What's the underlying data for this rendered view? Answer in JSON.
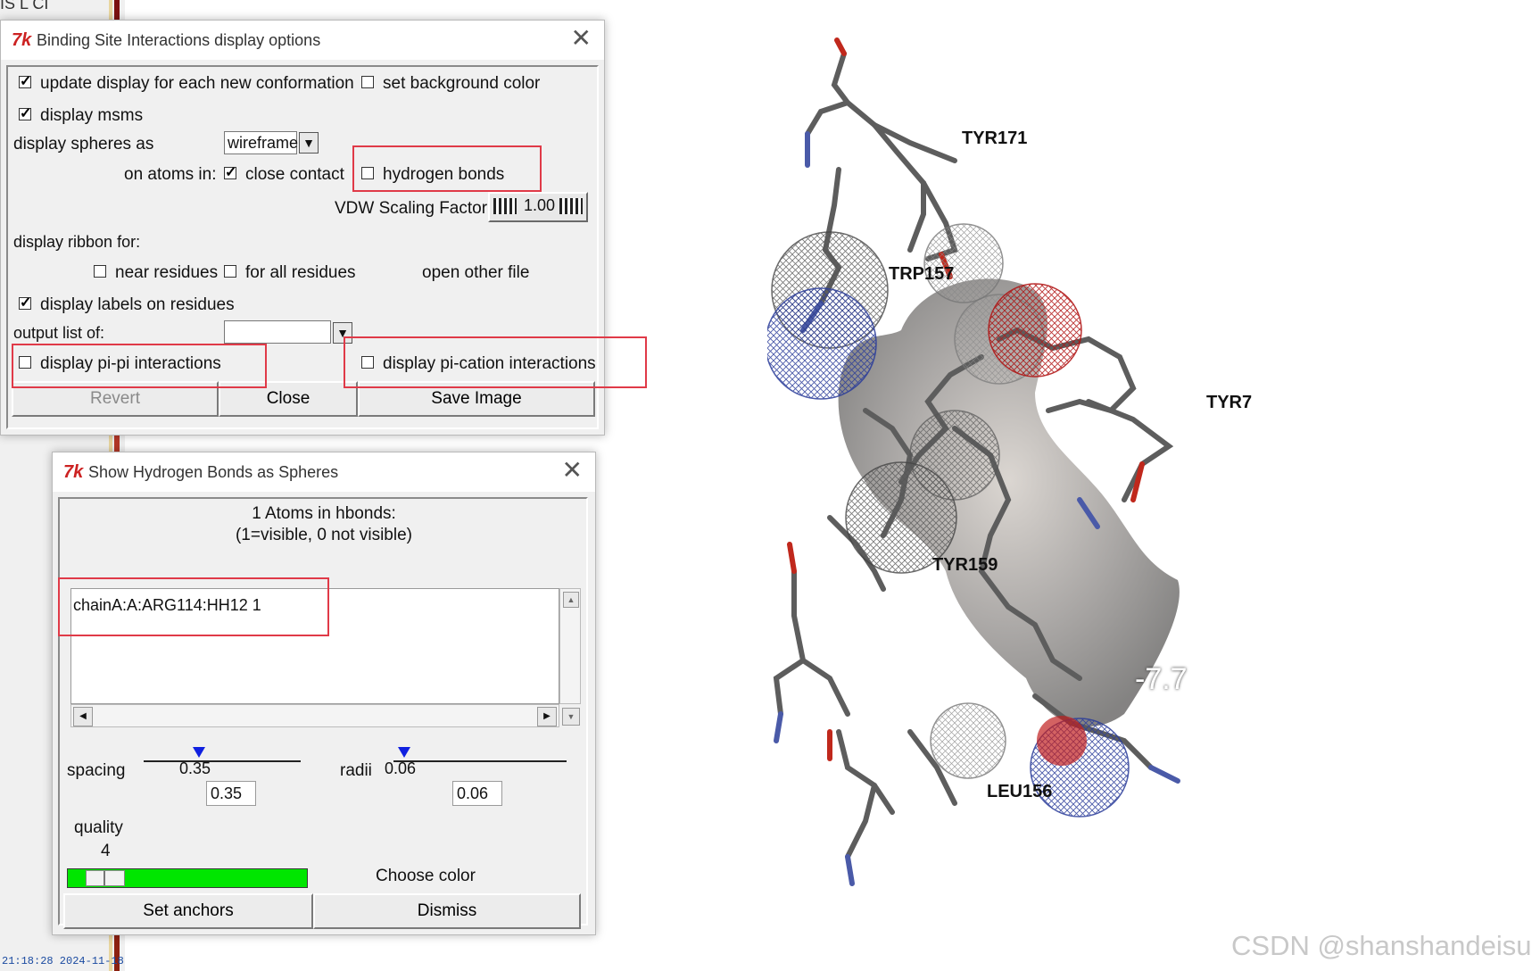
{
  "background": {
    "top_fragment": "IS L CI",
    "clock": "21:18:28 2024-11-18"
  },
  "main_dialog": {
    "title": "Binding Site Interactions display options",
    "update_display_label": "update display for each new conformation",
    "update_display_checked": true,
    "set_background_label": "set background color",
    "set_background_checked": false,
    "display_msms_label": "display msms",
    "display_msms_checked": true,
    "spheres_label": "display spheres as",
    "spheres_value": "wireframe",
    "on_atoms_label": "on atoms in:",
    "close_contact_label": "close contact",
    "close_contact_checked": true,
    "hydrogen_bonds_label": "hydrogen bonds",
    "hydrogen_bonds_checked": false,
    "vdw_label": "VDW Scaling Factor",
    "vdw_value": "1.00",
    "ribbon_label": "display ribbon for:",
    "near_residues_label": "near residues",
    "all_residues_label": "for all residues",
    "open_other_file_label": "open other file",
    "labels_on_residues_label": "display labels on residues",
    "labels_on_residues_checked": true,
    "output_list_label": "output list of:",
    "output_list_value": "",
    "pi_pi_label": "display pi-pi interactions",
    "pi_cation_label": "display pi-cation interactions",
    "revert_label": "Revert",
    "close_label": "Close",
    "save_image_label": "Save Image"
  },
  "hbond_dialog": {
    "title": "Show Hydrogen Bonds as Spheres",
    "header_line1": "1 Atoms in hbonds:",
    "header_line2": "(1=visible, 0 not visible)",
    "list_items": [
      "chainA:A:ARG114:HH12 1"
    ],
    "spacing_label": "spacing",
    "spacing_value": "0.35",
    "spacing_fraction": 0.35,
    "radii_label": "radii",
    "radii_value": "0.06",
    "radii_fraction": 0.06,
    "quality_label": "quality",
    "quality_value": "4",
    "quality_color": "#00e600",
    "choose_color_label": "Choose color",
    "set_anchors_label": "Set anchors",
    "dismiss_label": "Dismiss"
  },
  "molecule_view": {
    "residue_labels": [
      "TYR171",
      "TRP157",
      "TYR7",
      "TYR159",
      "LEU156"
    ],
    "score": "-7.7"
  },
  "watermark": "CSDN @shanshandeisu"
}
